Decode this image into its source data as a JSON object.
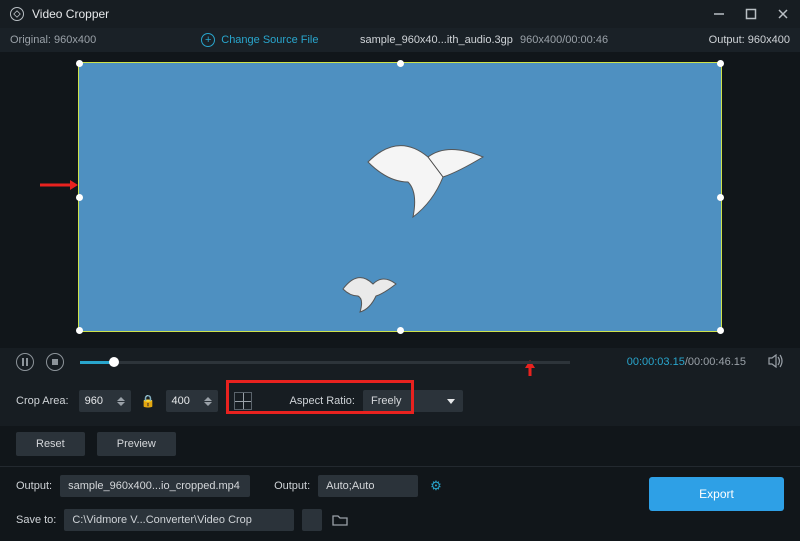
{
  "titlebar": {
    "title": "Video Cropper"
  },
  "infobar": {
    "original_label": "Original:",
    "original_value": "960x400",
    "change_source": "Change Source File",
    "filename": "sample_960x40...ith_audio.3gp",
    "dims_duration": "960x400/00:00:46",
    "output_label": "Output:",
    "output_value": "960x400"
  },
  "playback": {
    "current_time": "00:00:03.15",
    "total_time": "/00:00:46.15"
  },
  "crop": {
    "area_label": "Crop Area:",
    "width": "960",
    "height": "400",
    "aspect_label": "Aspect Ratio:",
    "aspect_value": "Freely",
    "reset": "Reset",
    "preview": "Preview"
  },
  "output": {
    "file_label": "Output:",
    "file_value": "sample_960x400...io_cropped.mp4",
    "fmt_label": "Output:",
    "fmt_value": "Auto;Auto"
  },
  "save": {
    "label": "Save to:",
    "path": "C:\\Vidmore V...Converter\\Video Crop"
  },
  "export": "Export"
}
